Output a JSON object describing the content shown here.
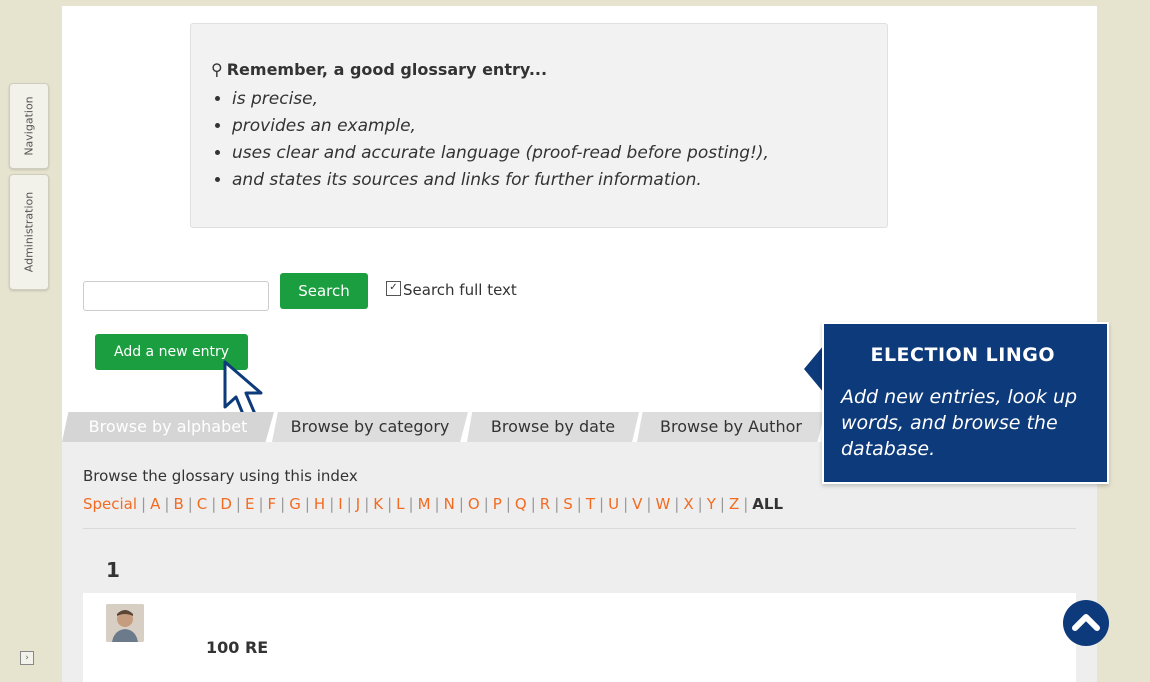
{
  "sidebar": {
    "tabs": [
      {
        "label": "Navigation"
      },
      {
        "label": "Administration"
      }
    ]
  },
  "callout": {
    "title": "Remember, a good glossary entry...",
    "items": [
      "is precise,",
      "provides an example,",
      "uses clear and accurate language (proof-read before posting!),",
      "and states its sources and links for further information."
    ]
  },
  "search": {
    "button_label": "Search",
    "fulltext_label": "Search full text",
    "fulltext_checked": true
  },
  "add_entry_label": "Add a new entry",
  "tabs": [
    {
      "label": "Browse by alphabet",
      "active": true
    },
    {
      "label": "Browse by category",
      "active": false
    },
    {
      "label": "Browse by date",
      "active": false
    },
    {
      "label": "Browse by Author",
      "active": false
    }
  ],
  "browse": {
    "hint": "Browse the glossary using this index",
    "special": "Special",
    "letters": [
      "A",
      "B",
      "C",
      "D",
      "E",
      "F",
      "G",
      "H",
      "I",
      "J",
      "K",
      "L",
      "M",
      "N",
      "O",
      "P",
      "Q",
      "R",
      "S",
      "T",
      "U",
      "V",
      "W",
      "X",
      "Y",
      "Z"
    ],
    "all": "ALL"
  },
  "section_letter": "1",
  "entry": {
    "title": "100 RE"
  },
  "banner": {
    "title": "ELECTION LINGO",
    "text": "Add new entries, look up words, and browse the database."
  },
  "colors": {
    "accent_green": "#1a9e3f",
    "banner_blue": "#0d3a7a",
    "link_orange": "#f26b21"
  },
  "icons": {
    "bulb": "lightbulb-icon",
    "cursor": "pointer-cursor-icon",
    "back_to_top": "chevron-up-icon",
    "dock": "dock-toggle-icon"
  }
}
